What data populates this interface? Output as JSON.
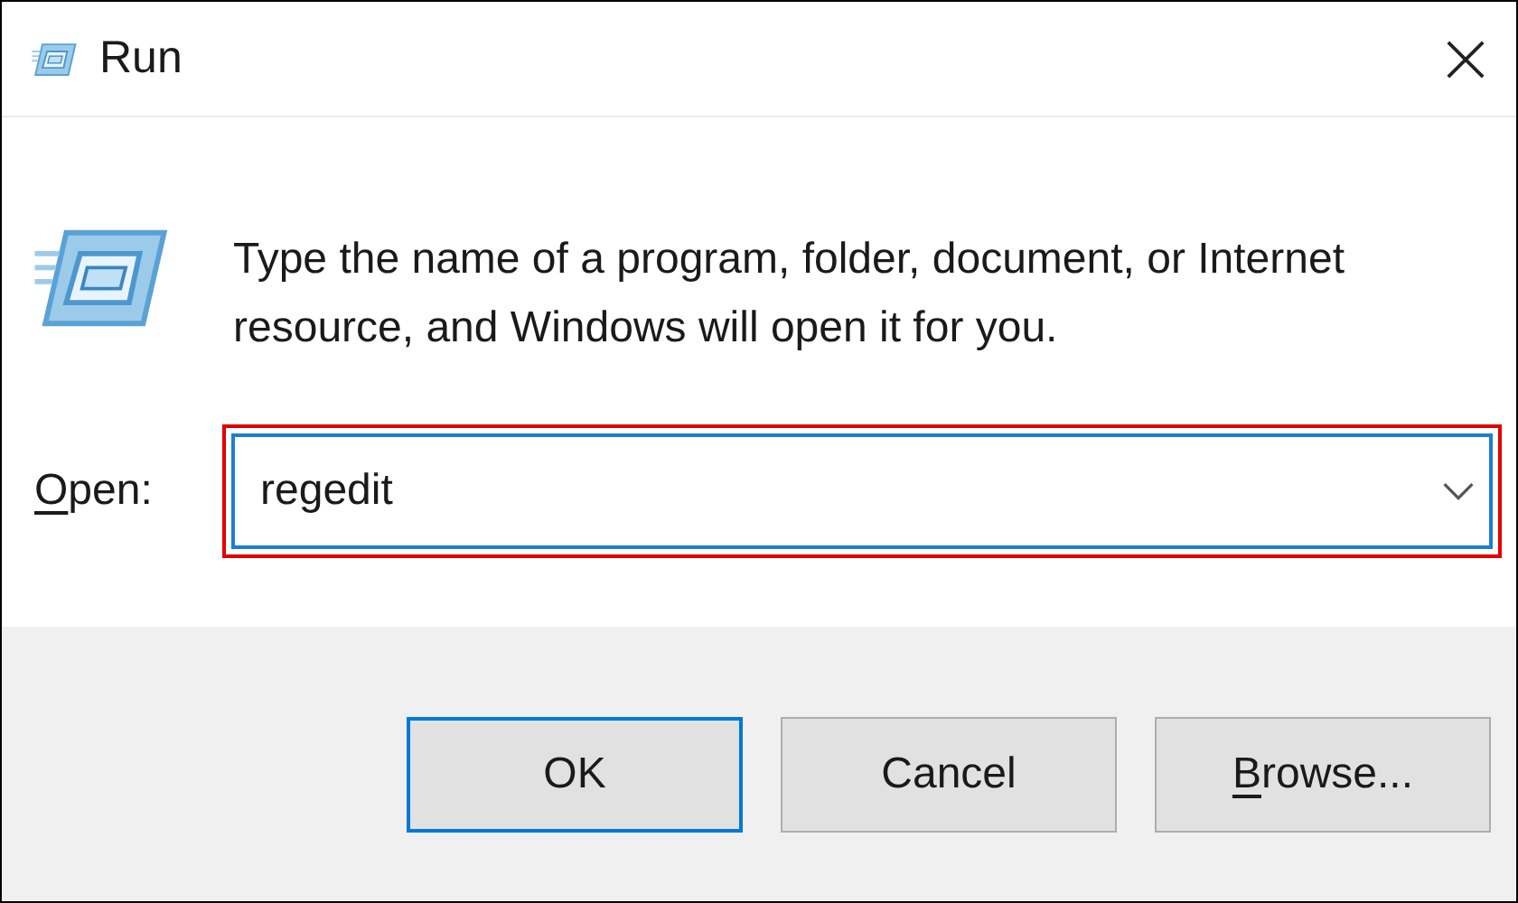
{
  "window": {
    "title": "Run"
  },
  "message": "Type the name of a program, folder, document, or Internet resource, and Windows will open it for you.",
  "open_field": {
    "label_parts": [
      {
        "text": "O",
        "underlined": true
      },
      {
        "text": "pen:",
        "underlined": false
      }
    ],
    "value": "regedit",
    "highlighted": true
  },
  "buttons": [
    {
      "label_parts": [
        {
          "text": "OK",
          "underlined": false
        }
      ],
      "default": true
    },
    {
      "label_parts": [
        {
          "text": "Cancel",
          "underlined": false
        }
      ],
      "default": false
    },
    {
      "label_parts": [
        {
          "text": "B",
          "underlined": true
        },
        {
          "text": "rowse...",
          "underlined": false
        }
      ],
      "default": false
    }
  ]
}
